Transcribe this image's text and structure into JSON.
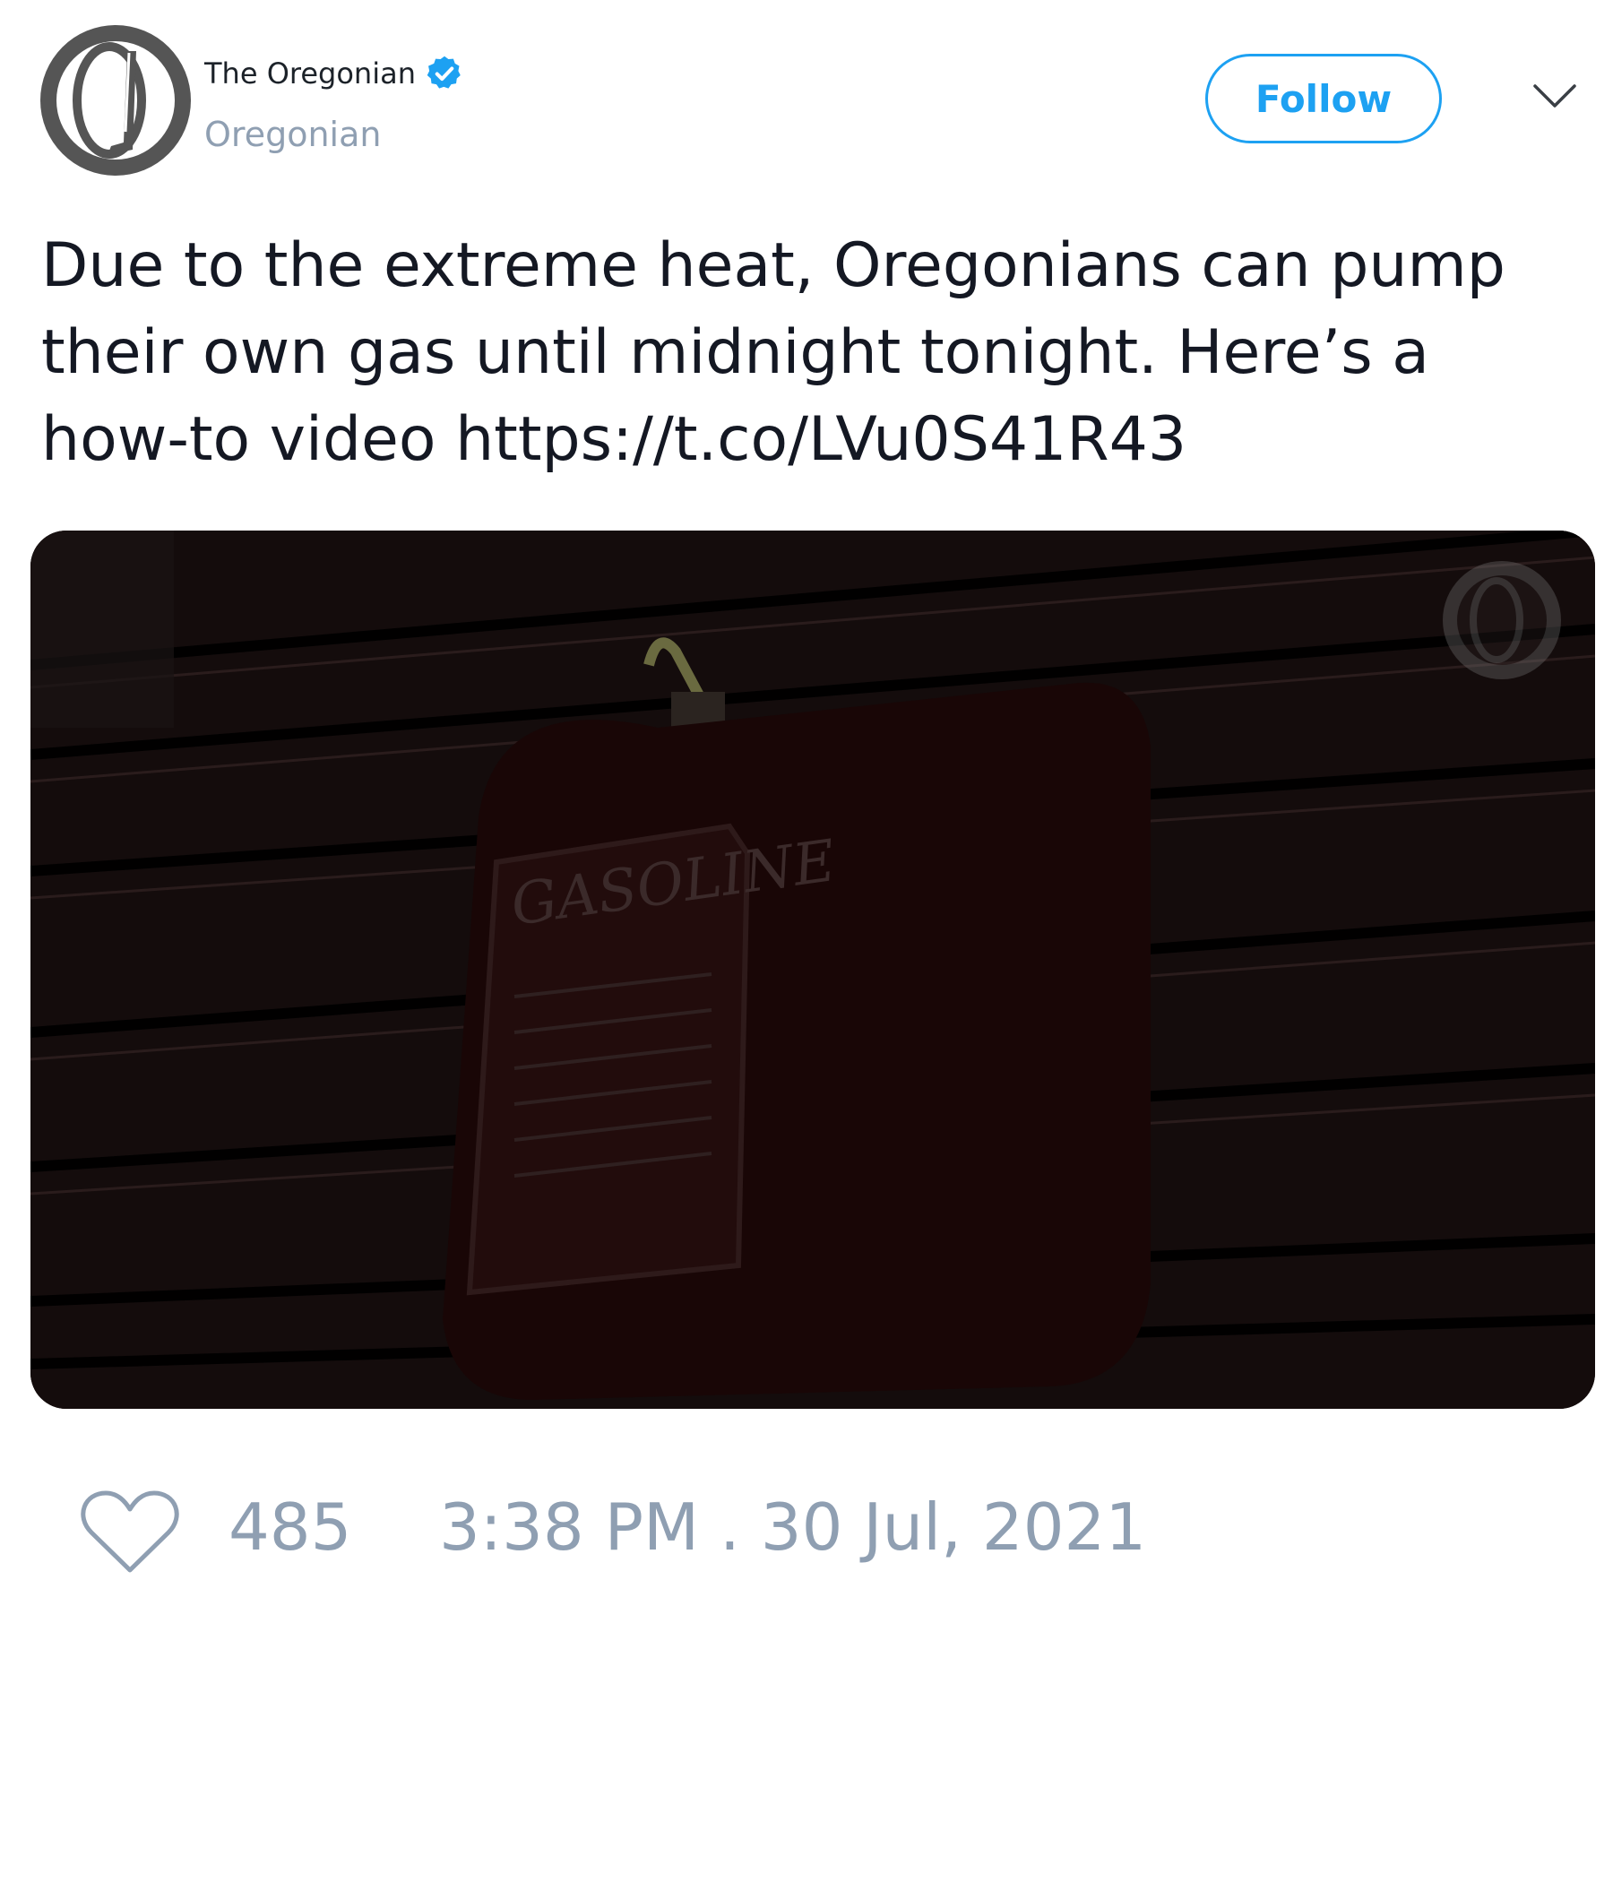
{
  "author": {
    "display_name": "The Oregonian",
    "handle": "Oregonian",
    "verified": true,
    "avatar_icon": "oregonian-logo-icon"
  },
  "actions": {
    "follow_label": "Follow",
    "menu_icon": "chevron-down-icon"
  },
  "tweet": {
    "text": "Due to the extreme heat, Oregonians can pump their own gas until midnight tonight. Here’s a how-to video https://t.co/LVu0S41R43"
  },
  "media": {
    "type": "video-thumbnail",
    "can_label": "GASOLINE",
    "watermark_icon": "oregonian-logo-icon"
  },
  "footer": {
    "like_icon": "heart-icon",
    "like_count": "485",
    "timestamp": "3:38 PM . 30 Jul, 2021"
  },
  "colors": {
    "accent": "#1da1f2",
    "muted": "#8f9fb2",
    "text": "#141823"
  }
}
